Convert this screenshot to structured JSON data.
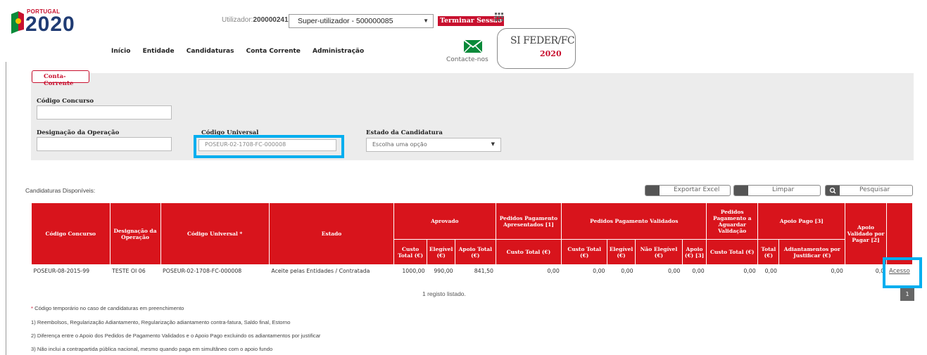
{
  "logo": {
    "country": "PORTUGAL",
    "year": "2020"
  },
  "header": {
    "user_label": "Utilizador:",
    "user_id": "200000241",
    "user_profile": "Super-utilizador - 500000085",
    "logout": "Terminar Sessão",
    "contact": "Contacte-nos",
    "sifeder_title": "SI FEDER/FC",
    "sifeder_year": "2020"
  },
  "nav": [
    "Início",
    "Entidade",
    "Candidaturas",
    "Conta Corrente",
    "Administração"
  ],
  "filters": {
    "tab": "Conta-Corrente",
    "codigo_concurso_label": "Código Concurso",
    "codigo_concurso_value": "",
    "designacao_label": "Designação da Operação",
    "designacao_value": "",
    "codigo_universal_label": "Código Universal",
    "codigo_universal_value": "POSEUR-02-1708-FC-000008",
    "estado_label": "Estado da Candidatura",
    "estado_value": "Escolha uma opção"
  },
  "toolbar": {
    "available": "Candidaturas Disponíveis:",
    "export": "Exportar Excel",
    "clear": "Limpar",
    "search": "Pesquisar"
  },
  "table": {
    "h": {
      "codigo_concurso": "Código Concurso",
      "designacao": "Designação da Operação",
      "codigo_universal": "Código Universal *",
      "estado": "Estado",
      "aprovado": "Aprovado",
      "pedidos_apresentados": "Pedidos Pagamento Apresentados [1]",
      "pedidos_validados": "Pedidos Pagamento Validados",
      "pedidos_aguardar": "Pedidos Pagamento a Aguardar Validação",
      "apoio_pago": "Apoio Pago [3]",
      "apoio_validado": "Apoio Validado por Pagar [2]",
      "custo_total": "Custo Total (€)",
      "elegivel": "Elegível (€)",
      "apoio_total": "Apoio Total (€)",
      "custo_total2": "Custo Total (€)",
      "custo_total3": "Custo Total (€)",
      "elegivel2": "Elegível (€)",
      "nao_elegivel": "Não Elegível (€)",
      "apoio3": "Apoio (€) [3]",
      "custo_total4": "Custo Total (€)",
      "total": "Total (€)",
      "adiantamentos": "Adiantamentos por Justificar (€)"
    },
    "row": {
      "codigo_concurso": "POSEUR-08-2015-99",
      "designacao": "TESTE OI 06",
      "codigo_universal": "POSEUR-02-1708-FC-000008",
      "estado": "Aceite pelas Entidades / Contratada",
      "custo_total": "1000,00",
      "elegivel": "990,00",
      "apoio_total": "841,50",
      "ped_apres_custo": "0,00",
      "ped_val_custo": "0,00",
      "ped_val_eleg": "0,00",
      "ped_val_nao_eleg": "0,00",
      "ped_val_apoio": "0,00",
      "ped_aguard_custo": "0,00",
      "pago_total": "0,00",
      "pago_adiant": "0,00",
      "validado_por_pagar": "0,0",
      "acesso": "Acesso"
    },
    "count": "1 registo listado.",
    "page": "1"
  },
  "notes": {
    "star": "*",
    "n0": " Código temporário no caso de candidaturas em preenchimento",
    "n1": "1) Reembolsos, Regularização Adiantamento, Regularização adiantamento contra-fatura, Saldo final, Estorno",
    "n2": "2) Diferença entre o Apoio dos Pedidos de Pagamento Validados e o Apoio Pago excluindo os adiantamentos por justificar",
    "n3": "3) Não inclui a contrapartida pública nacional, mesmo quando paga em simultâneo com o apoio fundo"
  },
  "colors": {
    "brand_red": "#d8141c",
    "highlight": "#00aeef",
    "navy": "#1f3b73"
  }
}
